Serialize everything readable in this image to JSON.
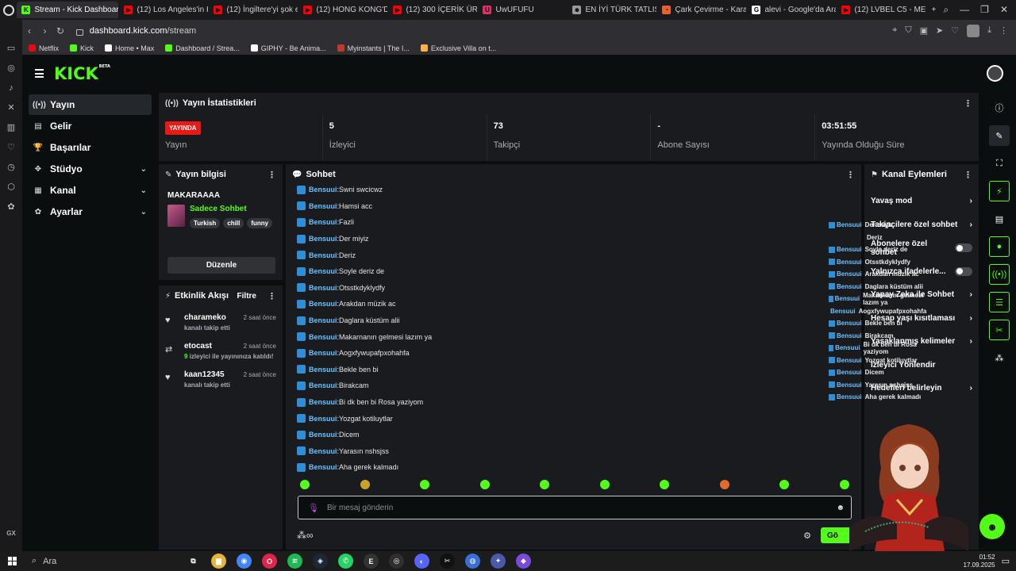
{
  "browser": {
    "tabs": [
      {
        "title": "Stream - Kick Dashboard",
        "color": "#53fc18",
        "icon": "K",
        "active": true
      },
      {
        "title": "(12) Los Angeles'in K",
        "color": "#ff0000",
        "icon": "▶"
      },
      {
        "title": "(12) İngiltere'yi şok e",
        "color": "#ff0000",
        "icon": "▶"
      },
      {
        "title": "(12) HONG KONG'DA",
        "color": "#ff0000",
        "icon": "▶"
      },
      {
        "title": "(12) 300 İÇERİK ÜRE",
        "color": "#ff0000",
        "icon": "▶"
      },
      {
        "title": "UwUFUFU",
        "color": "#e0306a",
        "icon": "U"
      },
      {
        "title": "EN İYİ TÜRK TATLISI",
        "color": "#999999",
        "icon": "☻"
      },
      {
        "title": "Çark Çevirme - Kara",
        "color": "#e8612a",
        "icon": "◔"
      },
      {
        "title": "alevi - Google'da Ara",
        "color": "#ffffff",
        "icon": "G"
      },
      {
        "title": "(12) LVBEL C5 - MEH",
        "color": "#ff0000",
        "icon": "▶"
      }
    ],
    "url_host": "dashboard.kick.com",
    "url_path": "/stream",
    "bookmarks": [
      {
        "label": "Netflix",
        "color": "#e50914"
      },
      {
        "label": "Kick",
        "color": "#53fc18"
      },
      {
        "label": "Home • Max",
        "color": "#ffffff"
      },
      {
        "label": "Dashboard / Strea...",
        "color": "#53fc18"
      },
      {
        "label": "GIPHY - Be Anima...",
        "color": "#ffffff"
      },
      {
        "label": "Myinstants | The I...",
        "color": "#c0392b"
      },
      {
        "label": "Exclusive Villa on t...",
        "color": "#ffb347"
      }
    ]
  },
  "nav": {
    "items": [
      {
        "label": "Yayın",
        "icon": "((•))",
        "active": true
      },
      {
        "label": "Gelir",
        "icon": "▤"
      },
      {
        "label": "Başarılar",
        "icon": "🏆"
      },
      {
        "label": "Stüdyo",
        "icon": "✥",
        "chevron": true
      },
      {
        "label": "Kanal",
        "icon": "▦",
        "chevron": true
      },
      {
        "label": "Ayarlar",
        "icon": "✿",
        "chevron": true
      }
    ]
  },
  "stats": {
    "title": "Yayın İstatistikleri",
    "live_badge": "YAYINDA",
    "items": [
      {
        "value": "",
        "label": "Yayın"
      },
      {
        "value": "5",
        "label": "İzleyici"
      },
      {
        "value": "73",
        "label": "Takipçi"
      },
      {
        "value": "-",
        "label": "Abone Sayısı"
      },
      {
        "value": "03:51:55",
        "label": "Yayında Olduğu Süre"
      }
    ]
  },
  "stream_info": {
    "header": "Yayın bilgisi",
    "title": "MAKARAAAA",
    "category": "Sadece Sohbet",
    "tags": [
      "Turkish",
      "chill",
      "funny"
    ],
    "edit_label": "Düzenle"
  },
  "activity": {
    "header": "Etkinlik Akışı",
    "filter": "Filtre",
    "items": [
      {
        "name": "charameko",
        "time": "2 saat önce",
        "desc": "kanalı takip etti",
        "icon": "♥"
      },
      {
        "name": "etocast",
        "time": "2 saat önce",
        "count": "9",
        "desc": " izleyici ile yayınınıza katıldı!",
        "icon": "⇄"
      },
      {
        "name": "kaan12345",
        "time": "2 saat önce",
        "desc": "kanalı takip etti",
        "icon": "♥"
      }
    ]
  },
  "chat": {
    "header": "Sohbet",
    "messages": [
      {
        "user": "Bensuui",
        "text": "Swni swcicwz"
      },
      {
        "user": "Bensuui",
        "text": "Hamsi acc"
      },
      {
        "user": "Bensuui",
        "text": "Fazli"
      },
      {
        "user": "Bensuui",
        "text": "Der miyiz"
      },
      {
        "user": "Bensuui",
        "text": "Deriz"
      },
      {
        "user": "Bensuui",
        "text": "Soyle deriz de"
      },
      {
        "user": "Bensuui",
        "text": "Otsstkdyklydfy"
      },
      {
        "user": "Bensuui",
        "text": "Arakdan müzik ac"
      },
      {
        "user": "Bensuui",
        "text": "Daglara küstüm alii"
      },
      {
        "user": "Bensuui",
        "text": "Makarnanın gelmesi lazım ya"
      },
      {
        "user": "Bensuui",
        "text": "Aogxfywupafpxohahfa"
      },
      {
        "user": "Bensuui",
        "text": "Bekle ben bi"
      },
      {
        "user": "Bensuui",
        "text": "Birakcam"
      },
      {
        "user": "Bensuui",
        "text": "Bi dk ben bi Rosa yaziyom"
      },
      {
        "user": "Bensuui",
        "text": "Yozgat kotiluytlar"
      },
      {
        "user": "Bensuui",
        "text": "Dicem"
      },
      {
        "user": "Bensuui",
        "text": "Yarasın nshsjss"
      },
      {
        "user": "Bensuui",
        "text": "Aha gerek kalmadı"
      }
    ],
    "placeholder": "Bir mesaj gönderin",
    "send_label": "Gö",
    "emote_colors": [
      "#53fc18",
      "#c9a227",
      "#53fc18",
      "#53fc18",
      "#53fc18",
      "#53fc18",
      "#53fc18",
      "#e06b2a",
      "#53fc18",
      "#53fc18"
    ]
  },
  "actions": {
    "header": "Kanal Eylemleri",
    "rows": [
      {
        "label": "Yavaş mod",
        "type": "chevron"
      },
      {
        "label": "Takipçilere özel sohbet",
        "type": "chevron"
      },
      {
        "label": "Abonelere özel sohbet",
        "type": "toggle"
      },
      {
        "label": "Yalnızca ifadelerle...",
        "type": "toggle"
      },
      {
        "label": "Yapay Zeka ile Sohbet",
        "type": "chevron"
      },
      {
        "label": "Hesap yaşı kısıtlaması",
        "type": "chevron"
      },
      {
        "label": "Yasaklanmış kelimeler",
        "type": "chevron"
      },
      {
        "label": "İzleyici Yönlendir",
        "type": "none"
      },
      {
        "label": "Hedefleri belirleyin",
        "type": "chevron"
      }
    ]
  },
  "ghost_chat": [
    {
      "user": "Bensuui",
      "text": "Der miyiz"
    },
    {
      "user": "",
      "text": "Deriz"
    },
    {
      "user": "Bensuui",
      "text": "Soyle deriz de"
    },
    {
      "user": "Bensuui",
      "text": "Otsstkdyklydfy"
    },
    {
      "user": "Bensuui",
      "text": "Arakdan müzik ac"
    },
    {
      "user": "Bensuui",
      "text": "Daglara küstüm alii"
    },
    {
      "user": "Bensuui",
      "text": "Makarnanın gelmesi lazım ya"
    },
    {
      "user": "Bensuui",
      "text": "Aogxfywupafpxohahfa"
    },
    {
      "user": "Bensuui",
      "text": "Bekle ben bi"
    },
    {
      "user": "Bensuui",
      "text": "Birakcam"
    },
    {
      "user": "Bensuui",
      "text": "Bi dk ben bi Rosa yaziyom"
    },
    {
      "user": "Bensuui",
      "text": "Yozgat kotiluytlar"
    },
    {
      "user": "Bensuui",
      "text": "Dicem"
    },
    {
      "user": "Bensuui",
      "text": "Yarasın nshsjss"
    },
    {
      "user": "Bensuui",
      "text": "Aha gerek kalmadı"
    }
  ],
  "taskbar": {
    "search_label": "Ara",
    "time": "01:52",
    "date": "17.09.2025",
    "apps": [
      {
        "name": "task-view",
        "color": "#1c1c1c",
        "glyph": "⧉"
      },
      {
        "name": "file-explorer",
        "color": "#e8b33a",
        "glyph": "▆"
      },
      {
        "name": "chrome",
        "color": "#4285f4",
        "glyph": "◉"
      },
      {
        "name": "opera-gx",
        "color": "#e0244a",
        "glyph": "O"
      },
      {
        "name": "spotify",
        "color": "#1db954",
        "glyph": "≋"
      },
      {
        "name": "steam",
        "color": "#1b2838",
        "glyph": "◈"
      },
      {
        "name": "whatsapp",
        "color": "#25d366",
        "glyph": "✆"
      },
      {
        "name": "epic-games",
        "color": "#333333",
        "glyph": "E"
      },
      {
        "name": "obs",
        "color": "#302e31",
        "glyph": "◎"
      },
      {
        "name": "discord",
        "color": "#5865f2",
        "glyph": "◐"
      },
      {
        "name": "capcut",
        "color": "#111111",
        "glyph": "✂"
      },
      {
        "name": "app-blue",
        "color": "#3a6fd8",
        "glyph": "◍"
      },
      {
        "name": "app-gear",
        "color": "#4a5aa8",
        "glyph": "✦"
      },
      {
        "name": "app-purple",
        "color": "#7a4ad8",
        "glyph": "◆"
      }
    ]
  }
}
